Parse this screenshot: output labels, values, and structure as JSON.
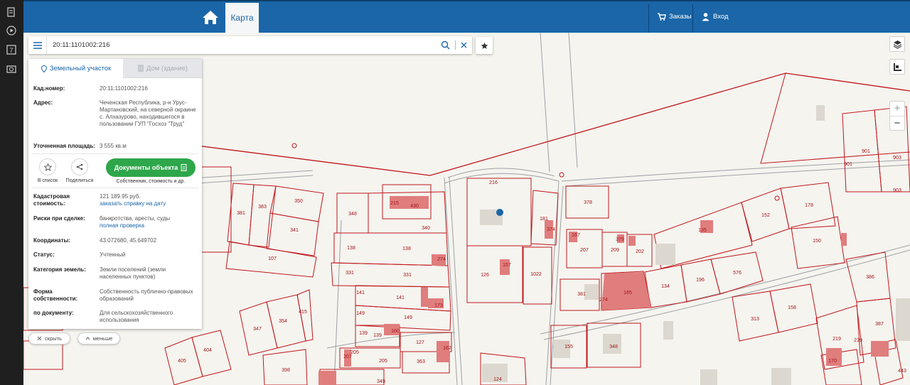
{
  "colors": {
    "header": "#1a66a8",
    "dock": "#1f1f1f",
    "parcel_line": "#c0171c",
    "building_fill": "#e07d7d",
    "accent_green": "#2ea64a"
  },
  "dock": {
    "icons": [
      "document-icon",
      "play-icon",
      "calendar-icon",
      "camera-icon"
    ],
    "calendar_day": "7"
  },
  "header": {
    "tab_map": "Карта",
    "orders": "Заказы",
    "login": "Вход"
  },
  "search": {
    "value": "20:11:1101002:216",
    "placeholder": ""
  },
  "panel": {
    "tab_land": "Земельный участок",
    "tab_house": "Дом (здание)",
    "kad_label": "Кад.номер:",
    "kad_value": "20:11:1101002:216",
    "address_label": "Адрес:",
    "address_value": "Чеченская Республика, р-н Урус-Мартановский, на северной окраине с. Алхазурово, находившегося в пользовании ГУП \"Госхоз \"Труд\"",
    "area_label": "Уточненная площадь:",
    "area_value": "3 555 кв.м",
    "action_list": "В список",
    "action_share": "Поделиться",
    "docs_button": "Документы объекта",
    "docs_sub": "Собственник, стоимость и др.",
    "cost_label": "Кадастровая стоимость:",
    "cost_value": "121 189.95 руб.",
    "cost_link": "заказать справку на дату",
    "risk_label": "Риски при сделке:",
    "risk_value": "банкротства, аресты, суды",
    "risk_link": "полная проверка",
    "coords_label": "Координаты:",
    "coords_value": "43.072680, 45.649702",
    "status_label": "Статус:",
    "status_value": "Учтенный",
    "category_label": "Категория земель:",
    "category_value": "Земли поселений (земли населенных пунктов)",
    "ownership_label": "Форма собственности:",
    "ownership_value": "Собственность публично-правовых образований",
    "bydoc_label": "по документу:",
    "bydoc_value": "Для сельскохозяйственного использования"
  },
  "buttons": {
    "hide": "скрыть",
    "less": "меньше"
  },
  "map": {
    "zoom_in": "+",
    "zoom_out": "−",
    "parcel_labels": [
      {
        "t": "216"
      },
      {
        "t": "378"
      },
      {
        "t": "181"
      },
      {
        "t": "374"
      },
      {
        "t": "126"
      },
      {
        "t": "1022"
      },
      {
        "t": "157"
      },
      {
        "t": "215"
      },
      {
        "t": "430"
      },
      {
        "t": "348"
      },
      {
        "t": "340"
      },
      {
        "t": "138"
      },
      {
        "t": "138"
      },
      {
        "t": "274"
      },
      {
        "t": "331"
      },
      {
        "t": "331"
      },
      {
        "t": "141"
      },
      {
        "t": "141"
      },
      {
        "t": "173"
      },
      {
        "t": "149"
      },
      {
        "t": "149"
      },
      {
        "t": "139"
      },
      {
        "t": "139"
      },
      {
        "t": "160"
      },
      {
        "t": "127"
      },
      {
        "t": "162"
      },
      {
        "t": "205"
      },
      {
        "t": "205"
      },
      {
        "t": "207"
      },
      {
        "t": "363"
      },
      {
        "t": "398"
      },
      {
        "t": "349"
      },
      {
        "t": "405"
      },
      {
        "t": "404"
      },
      {
        "t": "347"
      },
      {
        "t": "354"
      },
      {
        "t": "415"
      },
      {
        "t": "381"
      },
      {
        "t": "383"
      },
      {
        "t": "350"
      },
      {
        "t": "341"
      },
      {
        "t": "107"
      },
      {
        "t": "207"
      },
      {
        "t": "167"
      },
      {
        "t": "209"
      },
      {
        "t": "379"
      },
      {
        "t": "202"
      },
      {
        "t": "381"
      },
      {
        "t": "165"
      },
      {
        "t": "274"
      },
      {
        "t": "155"
      },
      {
        "t": "348"
      },
      {
        "t": "124"
      },
      {
        "t": "135"
      },
      {
        "t": "152"
      },
      {
        "t": "178"
      },
      {
        "t": "150"
      },
      {
        "t": "134"
      },
      {
        "t": "196"
      },
      {
        "t": "576"
      },
      {
        "t": "313"
      },
      {
        "t": "158"
      },
      {
        "t": "219"
      },
      {
        "t": "386"
      },
      {
        "t": "387"
      },
      {
        "t": "901"
      },
      {
        "t": "903"
      },
      {
        "t": "901"
      },
      {
        "t": "903"
      },
      {
        "t": "443"
      },
      {
        "t": "170"
      },
      {
        "t": "219"
      }
    ]
  }
}
